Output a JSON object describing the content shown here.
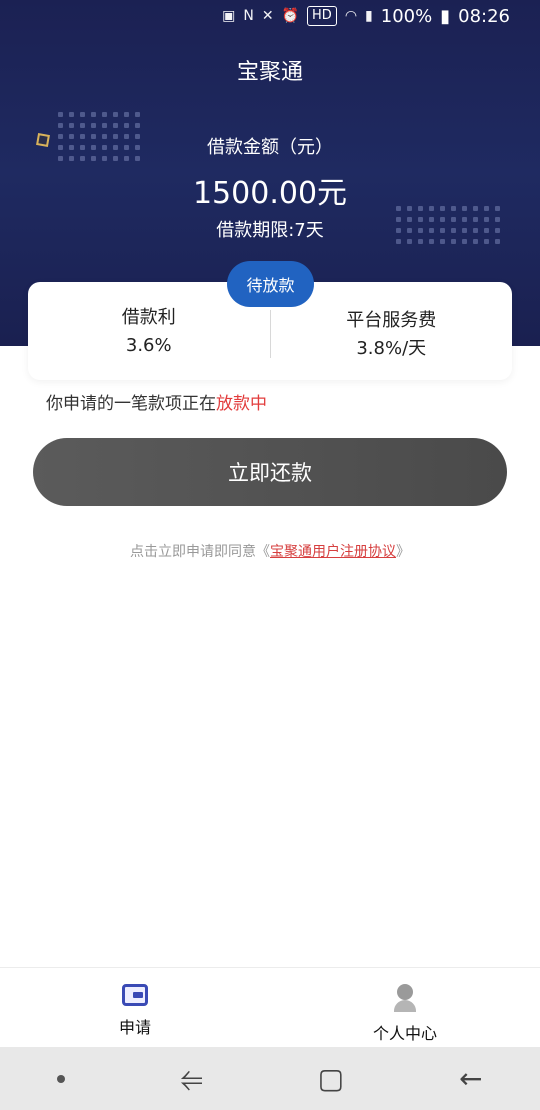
{
  "status_bar": {
    "hd": "HD",
    "battery": "100%",
    "time": "08:26"
  },
  "app": {
    "title": "宝聚通"
  },
  "loan": {
    "amount_label": "借款金额（元）",
    "amount": "1500.00元",
    "term": "借款期限:7天",
    "status_pill": "待放款"
  },
  "card": {
    "interest_label": "借款利",
    "interest_value": "3.6%",
    "fee_label": "平台服务费",
    "fee_value": "3.8%/天"
  },
  "status": {
    "prefix": "你申请的一笔款项正在",
    "highlight": "放款中"
  },
  "actions": {
    "repay_label": "立即还款"
  },
  "agreement": {
    "prefix": "点击立即申请即同意《",
    "link": "宝聚通用户注册协议",
    "suffix": "》"
  },
  "tabs": [
    {
      "label": "申请",
      "icon": "wallet-icon"
    },
    {
      "label": "个人中心",
      "icon": "person-icon"
    }
  ],
  "colors": {
    "header_bg": "#1f2a61",
    "pill_bg": "#2163c1",
    "highlight_red": "#e23c3c",
    "button_bg": "#555555"
  }
}
